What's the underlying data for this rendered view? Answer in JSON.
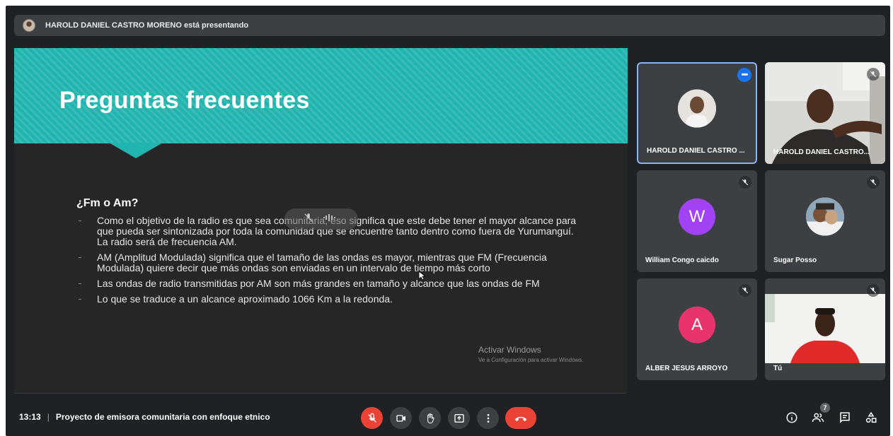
{
  "presenter": {
    "text": "HAROLD DANIEL CASTRO MORENO está presentando"
  },
  "slide": {
    "title": "Preguntas frecuentes",
    "question": "¿Fm o Am?",
    "bullets": [
      "Como el objetivo de la radio es que sea comunitaria, eso significa que este debe tener el mayor alcance para que pueda ser sintonizada por toda la comunidad que se encuentre tanto dentro como fuera de Yurumanguí. La radio será de frecuencia AM.",
      "AM (Amplitud Modulada) significa que el tamaño de las ondas es mayor, mientras que FM (Frecuencia Modulada) quiere decir que más ondas son enviadas en un intervalo de tiempo más corto",
      "Las ondas de radio transmitidas por AM son más grandes en tamaño y alcance que las ondas de FM",
      "Lo que se traduce a un alcance aproximado 1066 Km a la redonda."
    ],
    "watermark_title": "Activar Windows",
    "watermark_sub": "Ve a Configuración para activar Windows."
  },
  "participants": [
    {
      "name": "HAROLD DANIEL CASTRO ...",
      "type": "avatar-photo",
      "active": true
    },
    {
      "name": "HAROLD DANIEL CASTRO...",
      "type": "camera",
      "muted": true
    },
    {
      "name": "William Congo caicdo",
      "type": "letter",
      "letter": "W",
      "color": "#a142f4",
      "muted": true
    },
    {
      "name": "Sugar Posso",
      "type": "avatar-photo",
      "muted": true
    },
    {
      "name": "ALBER JESUS ARROYO",
      "type": "letter",
      "letter": "A",
      "color": "#e8336d",
      "muted": true
    },
    {
      "name": "Tú",
      "type": "camera",
      "muted": true
    }
  ],
  "bottom_bar": {
    "time": "13:13",
    "separator": "|",
    "meeting_title": "Proyecto de emisora comunitaria con enfoque etnico",
    "controls": [
      "mic-off-icon",
      "camera-icon",
      "raise-hand-icon",
      "present-screen-icon",
      "more-options-icon",
      "end-call-icon"
    ],
    "participant_count": "7",
    "right_icons": [
      "info-icon",
      "people-icon",
      "chat-icon",
      "activities-icon"
    ]
  },
  "colors": {
    "background": "#202124",
    "tile": "#3c4043",
    "slide_teal": "#22b4ae",
    "end_call_red": "#ea4335",
    "active_border": "#8ab4f8"
  }
}
